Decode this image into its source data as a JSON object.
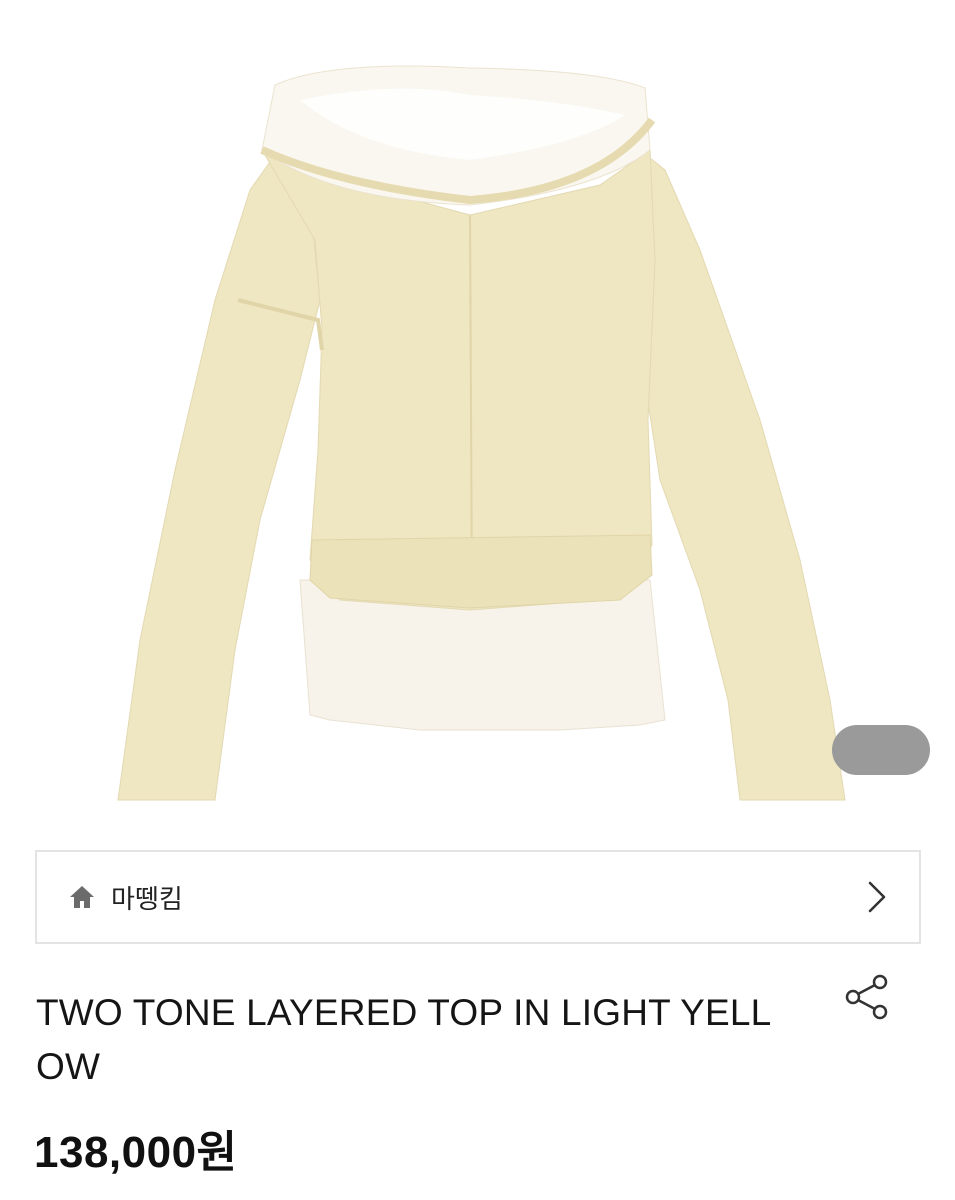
{
  "shop": {
    "name": "마뗑킴"
  },
  "product": {
    "title": "TWO TONE LAYERED TOP IN LIGHT YELLOW",
    "price": "138,000원"
  },
  "icons": {
    "home": "home-icon",
    "chevron": "chevron-right-icon",
    "share": "share-icon"
  },
  "colors": {
    "garment_yellow": "#efe6c2",
    "garment_white": "#f7f3ea",
    "indicator": "#9a9a9a",
    "border": "#e3e3e3"
  }
}
